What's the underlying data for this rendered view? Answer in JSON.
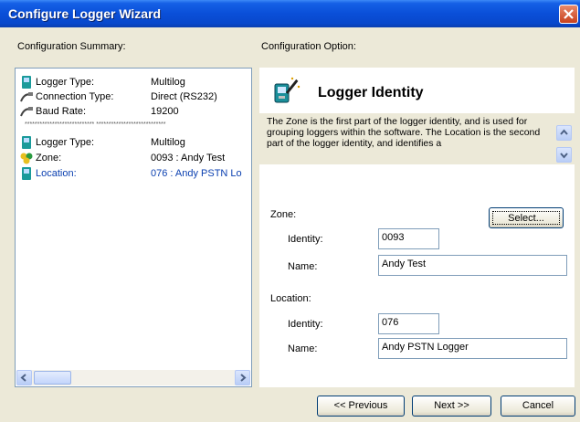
{
  "window": {
    "title": "Configure Logger Wizard"
  },
  "left": {
    "caption": "Configuration Summary:",
    "rows": [
      {
        "key": "Logger Type:",
        "value": "Multilog",
        "icon": "logger-icon"
      },
      {
        "key": "Connection Type:",
        "value": "Direct (RS232)",
        "icon": "cable-icon"
      },
      {
        "key": "Baud Rate:",
        "value": "19200",
        "icon": "cable-icon"
      },
      {
        "key": "Logger Type:",
        "value": "Multilog",
        "icon": "logger-icon"
      },
      {
        "key": "Zone:",
        "value": "0093 : Andy Test",
        "icon": "zone-icon"
      },
      {
        "key": "Location:",
        "value": "076 : Andy PSTN Lo",
        "icon": "logger-icon"
      }
    ],
    "separator": "**************************** ****************************"
  },
  "right": {
    "caption": "Configuration Option:",
    "heading": "Logger Identity",
    "description": "The Zone is the first part of the logger identity, and is used for grouping loggers within the software. The Location is the second part of the logger identity, and identifies a",
    "zone": {
      "label": "Zone:",
      "select_label": "Select...",
      "identity_label": "Identity:",
      "identity_value": "0093",
      "name_label": "Name:",
      "name_value": "Andy Test"
    },
    "location": {
      "label": "Location:",
      "identity_label": "Identity:",
      "identity_value": "076",
      "name_label": "Name:",
      "name_value": "Andy PSTN Logger"
    }
  },
  "buttons": {
    "previous": "<< Previous",
    "next": "Next >>",
    "cancel": "Cancel"
  },
  "colors": {
    "titlebar": "#0a4fd8",
    "face": "#ece9d8",
    "link_text": "#0a3fb0"
  }
}
